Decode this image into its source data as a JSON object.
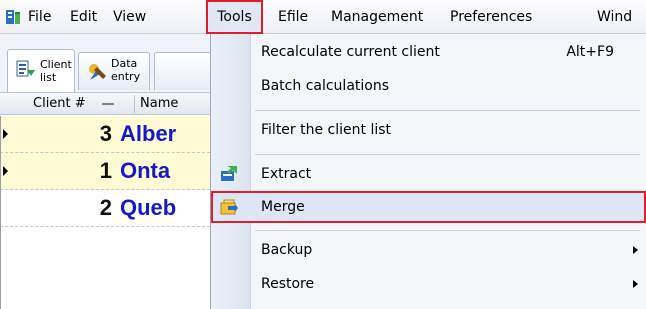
{
  "menubar": {
    "items": [
      {
        "label": "File"
      },
      {
        "label": "Edit"
      },
      {
        "label": "View"
      },
      {
        "label": "Tools"
      },
      {
        "label": "Efile"
      },
      {
        "label": "Management"
      },
      {
        "label": "Preferences"
      },
      {
        "label": "Wind"
      }
    ]
  },
  "tabs": [
    {
      "label": "Client\nlist"
    },
    {
      "label": "Data\nentry"
    }
  ],
  "columns": {
    "client_no": "Client #",
    "name": "Name"
  },
  "rows": [
    {
      "number": "3",
      "name": "Alber"
    },
    {
      "number": "1",
      "name": "Onta"
    },
    {
      "number": "2",
      "name": "Queb"
    }
  ],
  "tools_menu": {
    "recalculate": "Recalculate current client",
    "recalculate_shortcut": "Alt+F9",
    "batch": "Batch calculations",
    "filter": "Filter the client list",
    "extract": "Extract",
    "merge": "Merge",
    "backup": "Backup",
    "restore": "Restore"
  },
  "colors": {
    "highlight_border": "#e01e2b",
    "row_highlight": "#fffbd4",
    "client_name": "#1518c8"
  }
}
